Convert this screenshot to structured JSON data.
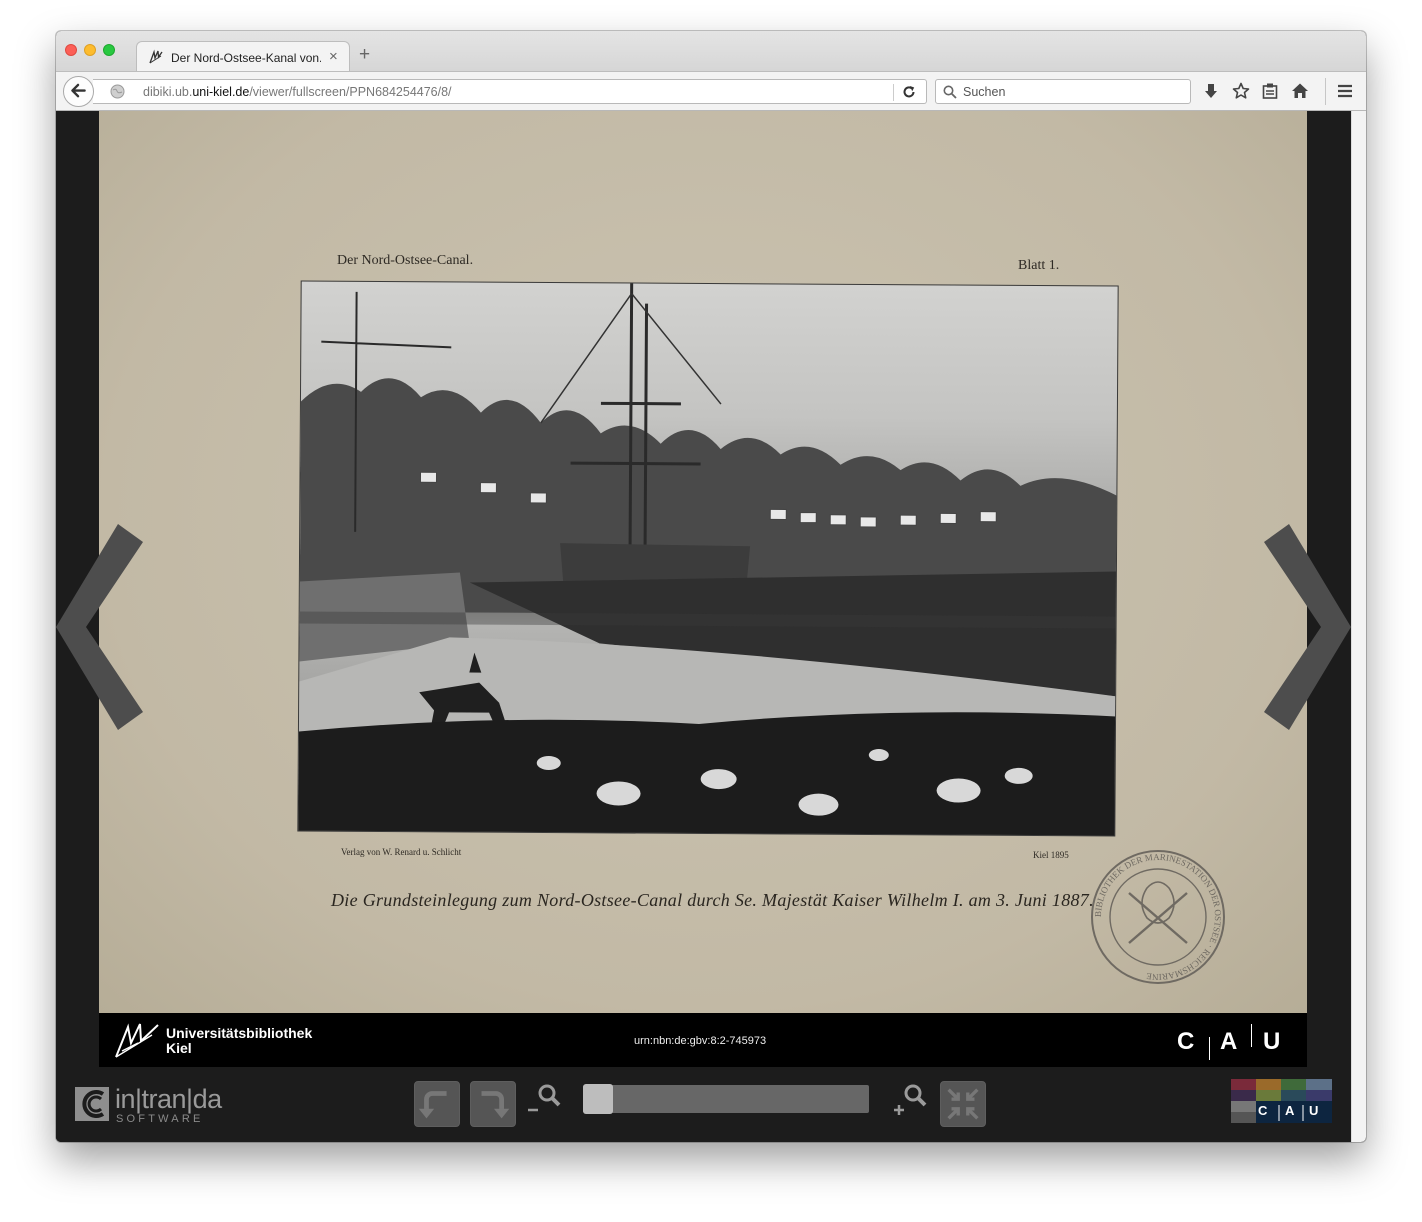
{
  "browser": {
    "tab_title": "Der Nord-Ostsee-Kanal von...",
    "close_glyph": "×",
    "new_tab_glyph": "+",
    "url_prefix": "dibiki.ub.",
    "url_domain": "uni-kiel.de",
    "url_path": "/viewer/fullscreen/PPN684254476/8/",
    "search_placeholder": "Suchen"
  },
  "document_page": {
    "header_left": "Der Nord-Ostsee-Canal.",
    "header_right": "Blatt 1.",
    "credit_left": "Verlag von W. Renard u. Schlicht",
    "credit_right": "Kiel 1895",
    "caption": "Die Grundsteinlegung zum Nord-Ostsee-Canal durch Se. Majestät Kaiser Wilhelm I. am 3. Juni 1887.",
    "stamp_text": "BIBLIOTHEK DER MARINESTATION DER OSTSEE · REICHSMARINE"
  },
  "footer": {
    "library_line1": "Universitätsbibliothek",
    "library_line2": "Kiel",
    "urn": "urn:nbn:de:gbv:8:2-745973",
    "cau_letters": [
      "C",
      "A",
      "U"
    ]
  },
  "viewer_toolbar": {
    "logo_main": "in|tran|da",
    "logo_sub": "SOFTWARE",
    "zoom_level": 0.0,
    "cau_small_letters": [
      "C",
      "A",
      "U"
    ]
  },
  "icons": {
    "back": "back-arrow-icon",
    "globe": "globe-icon",
    "reload": "reload-icon",
    "search": "search-icon",
    "download": "download-icon",
    "bookmark": "star-icon",
    "reading_list": "clipboard-icon",
    "home": "home-icon",
    "menu": "hamburger-menu-icon",
    "prev_page": "chevron-left-icon",
    "next_page": "chevron-right-icon",
    "rotate_left": "rotate-left-icon",
    "rotate_right": "rotate-right-icon",
    "zoom_out": "zoom-out-icon",
    "zoom_in": "zoom-in-icon",
    "exit_fullscreen": "exit-fullscreen-icon"
  },
  "colors": {
    "viewer_background": "#1c1c1c",
    "page_paper": "#c2b9a5",
    "footer_bar": "#000000"
  }
}
